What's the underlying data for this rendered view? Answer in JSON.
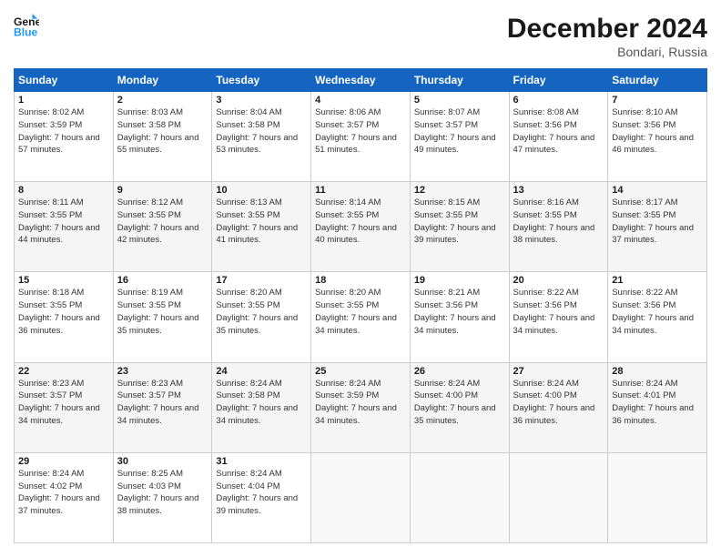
{
  "header": {
    "logo_line1": "General",
    "logo_line2": "Blue",
    "month": "December 2024",
    "location": "Bondari, Russia"
  },
  "weekdays": [
    "Sunday",
    "Monday",
    "Tuesday",
    "Wednesday",
    "Thursday",
    "Friday",
    "Saturday"
  ],
  "weeks": [
    [
      {
        "day": 1,
        "rise": "8:02 AM",
        "set": "3:59 PM",
        "hours": "7 hours and 57 minutes"
      },
      {
        "day": 2,
        "rise": "8:03 AM",
        "set": "3:58 PM",
        "hours": "7 hours and 55 minutes"
      },
      {
        "day": 3,
        "rise": "8:04 AM",
        "set": "3:58 PM",
        "hours": "7 hours and 53 minutes"
      },
      {
        "day": 4,
        "rise": "8:06 AM",
        "set": "3:57 PM",
        "hours": "7 hours and 51 minutes"
      },
      {
        "day": 5,
        "rise": "8:07 AM",
        "set": "3:57 PM",
        "hours": "7 hours and 49 minutes"
      },
      {
        "day": 6,
        "rise": "8:08 AM",
        "set": "3:56 PM",
        "hours": "7 hours and 47 minutes"
      },
      {
        "day": 7,
        "rise": "8:10 AM",
        "set": "3:56 PM",
        "hours": "7 hours and 46 minutes"
      }
    ],
    [
      {
        "day": 8,
        "rise": "8:11 AM",
        "set": "3:55 PM",
        "hours": "7 hours and 44 minutes"
      },
      {
        "day": 9,
        "rise": "8:12 AM",
        "set": "3:55 PM",
        "hours": "7 hours and 42 minutes"
      },
      {
        "day": 10,
        "rise": "8:13 AM",
        "set": "3:55 PM",
        "hours": "7 hours and 41 minutes"
      },
      {
        "day": 11,
        "rise": "8:14 AM",
        "set": "3:55 PM",
        "hours": "7 hours and 40 minutes"
      },
      {
        "day": 12,
        "rise": "8:15 AM",
        "set": "3:55 PM",
        "hours": "7 hours and 39 minutes"
      },
      {
        "day": 13,
        "rise": "8:16 AM",
        "set": "3:55 PM",
        "hours": "7 hours and 38 minutes"
      },
      {
        "day": 14,
        "rise": "8:17 AM",
        "set": "3:55 PM",
        "hours": "7 hours and 37 minutes"
      }
    ],
    [
      {
        "day": 15,
        "rise": "8:18 AM",
        "set": "3:55 PM",
        "hours": "7 hours and 36 minutes"
      },
      {
        "day": 16,
        "rise": "8:19 AM",
        "set": "3:55 PM",
        "hours": "7 hours and 35 minutes"
      },
      {
        "day": 17,
        "rise": "8:20 AM",
        "set": "3:55 PM",
        "hours": "7 hours and 35 minutes"
      },
      {
        "day": 18,
        "rise": "8:20 AM",
        "set": "3:55 PM",
        "hours": "7 hours and 34 minutes"
      },
      {
        "day": 19,
        "rise": "8:21 AM",
        "set": "3:56 PM",
        "hours": "7 hours and 34 minutes"
      },
      {
        "day": 20,
        "rise": "8:22 AM",
        "set": "3:56 PM",
        "hours": "7 hours and 34 minutes"
      },
      {
        "day": 21,
        "rise": "8:22 AM",
        "set": "3:56 PM",
        "hours": "7 hours and 34 minutes"
      }
    ],
    [
      {
        "day": 22,
        "rise": "8:23 AM",
        "set": "3:57 PM",
        "hours": "7 hours and 34 minutes"
      },
      {
        "day": 23,
        "rise": "8:23 AM",
        "set": "3:57 PM",
        "hours": "7 hours and 34 minutes"
      },
      {
        "day": 24,
        "rise": "8:24 AM",
        "set": "3:58 PM",
        "hours": "7 hours and 34 minutes"
      },
      {
        "day": 25,
        "rise": "8:24 AM",
        "set": "3:59 PM",
        "hours": "7 hours and 34 minutes"
      },
      {
        "day": 26,
        "rise": "8:24 AM",
        "set": "4:00 PM",
        "hours": "7 hours and 35 minutes"
      },
      {
        "day": 27,
        "rise": "8:24 AM",
        "set": "4:00 PM",
        "hours": "7 hours and 36 minutes"
      },
      {
        "day": 28,
        "rise": "8:24 AM",
        "set": "4:01 PM",
        "hours": "7 hours and 36 minutes"
      }
    ],
    [
      {
        "day": 29,
        "rise": "8:24 AM",
        "set": "4:02 PM",
        "hours": "7 hours and 37 minutes"
      },
      {
        "day": 30,
        "rise": "8:25 AM",
        "set": "4:03 PM",
        "hours": "7 hours and 38 minutes"
      },
      {
        "day": 31,
        "rise": "8:24 AM",
        "set": "4:04 PM",
        "hours": "7 hours and 39 minutes"
      },
      null,
      null,
      null,
      null
    ]
  ]
}
